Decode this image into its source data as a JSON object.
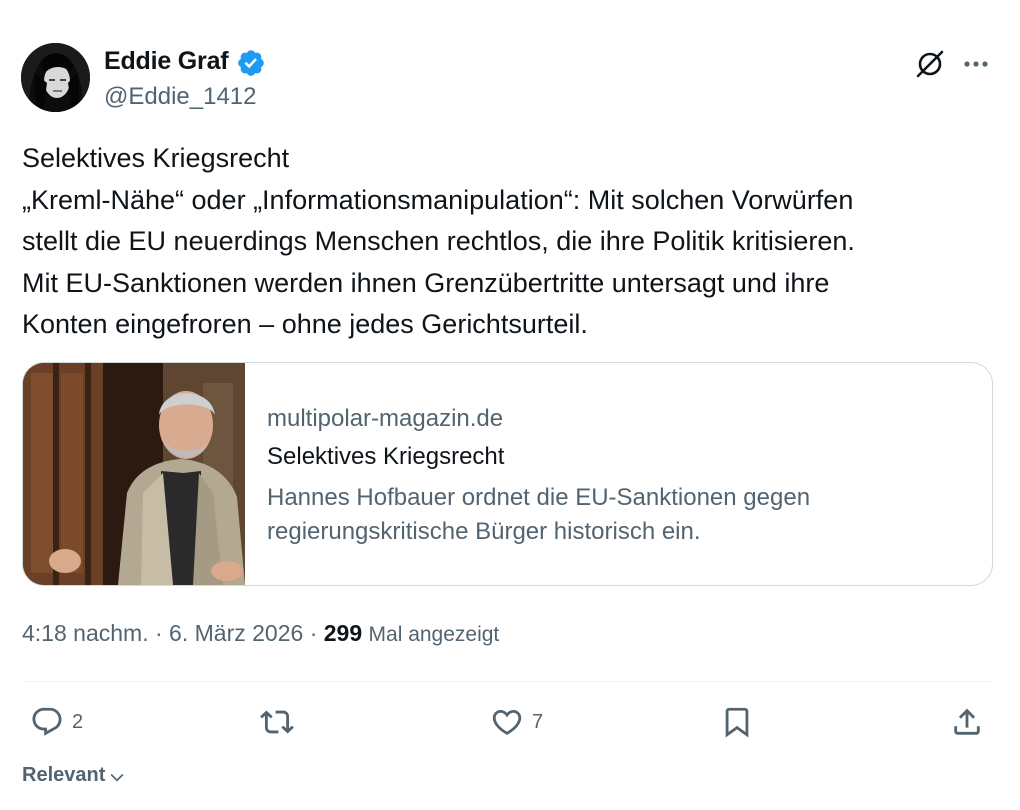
{
  "author": {
    "name": "Eddie Graf",
    "handle": "@Eddie_1412",
    "verified": true,
    "verified_color": "#1d9bf0"
  },
  "tweet": {
    "lines": [
      "Selektives Kriegsrecht",
      "„Kreml-Nähe“ oder „Informationsmanipulation“: Mit solchen Vorwürfen",
      "stellt die EU neuerdings Menschen rechtlos, die ihre Politik kritisieren.",
      "Mit EU-Sanktionen werden ihnen Grenzübertritte untersagt und ihre",
      "Konten eingefroren – ohne jedes Gerichtsurteil."
    ]
  },
  "card": {
    "domain": "multipolar-magazin.de",
    "title": "Selektives Kriegsrecht",
    "description_lines": [
      "Hannes Hofbauer ordnet die EU-Sanktionen gegen",
      "regierungskritische Bürger historisch ein."
    ]
  },
  "meta": {
    "time": "4:18 nachm.",
    "separator": "·",
    "date": "6. März 2026",
    "views_count": "299",
    "views_label": "Mal angezeigt"
  },
  "actions": {
    "reply_count": "2",
    "like_count": "7"
  },
  "sort": {
    "label": "Relevant"
  },
  "icons": {
    "grok": "grok-icon",
    "more": "more-icon",
    "reply": "reply-icon",
    "retweet": "retweet-icon",
    "like": "heart-icon",
    "bookmark": "bookmark-icon",
    "share": "share-icon",
    "chevron": "chevron-down-icon"
  },
  "colors": {
    "text_primary": "#0f1419",
    "text_secondary": "#536471",
    "border": "#cfd9de",
    "accent": "#1d9bf0"
  }
}
